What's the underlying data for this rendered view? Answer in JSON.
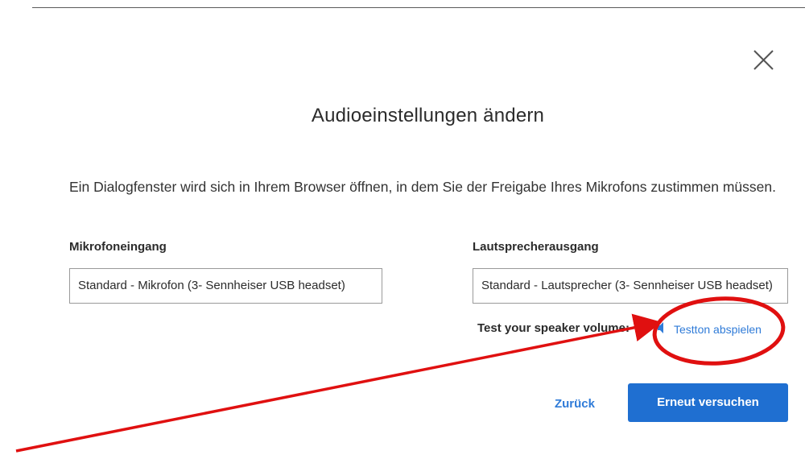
{
  "dialog": {
    "close_icon": "close-icon",
    "title": "Audioeinstellungen ändern",
    "intro": "Ein Dialogfenster wird sich in Ihrem Browser öffnen, in dem Sie der Freigabe Ihres Mikrofons zustimmen müssen."
  },
  "microphone": {
    "label": "Mikrofoneingang",
    "selected": "Standard - Mikrofon (3- Sennheiser USB headset)"
  },
  "speaker": {
    "label": "Lautsprecherausgang",
    "selected": "Standard - Lautsprecher (3- Sennheiser USB headset)",
    "test_label": "Test your speaker volume:",
    "speaker_icon": "speaker-icon",
    "test_link": "Testton abspielen"
  },
  "buttons": {
    "back": "Zurück",
    "retry": "Erneut versuchen"
  },
  "annotation": {
    "color": "#e01010",
    "shapes": [
      "red-circle",
      "red-arrow"
    ]
  },
  "colors": {
    "primary": "#1f6fd1",
    "link": "#2f7bd8",
    "text": "#2b2b2b"
  }
}
